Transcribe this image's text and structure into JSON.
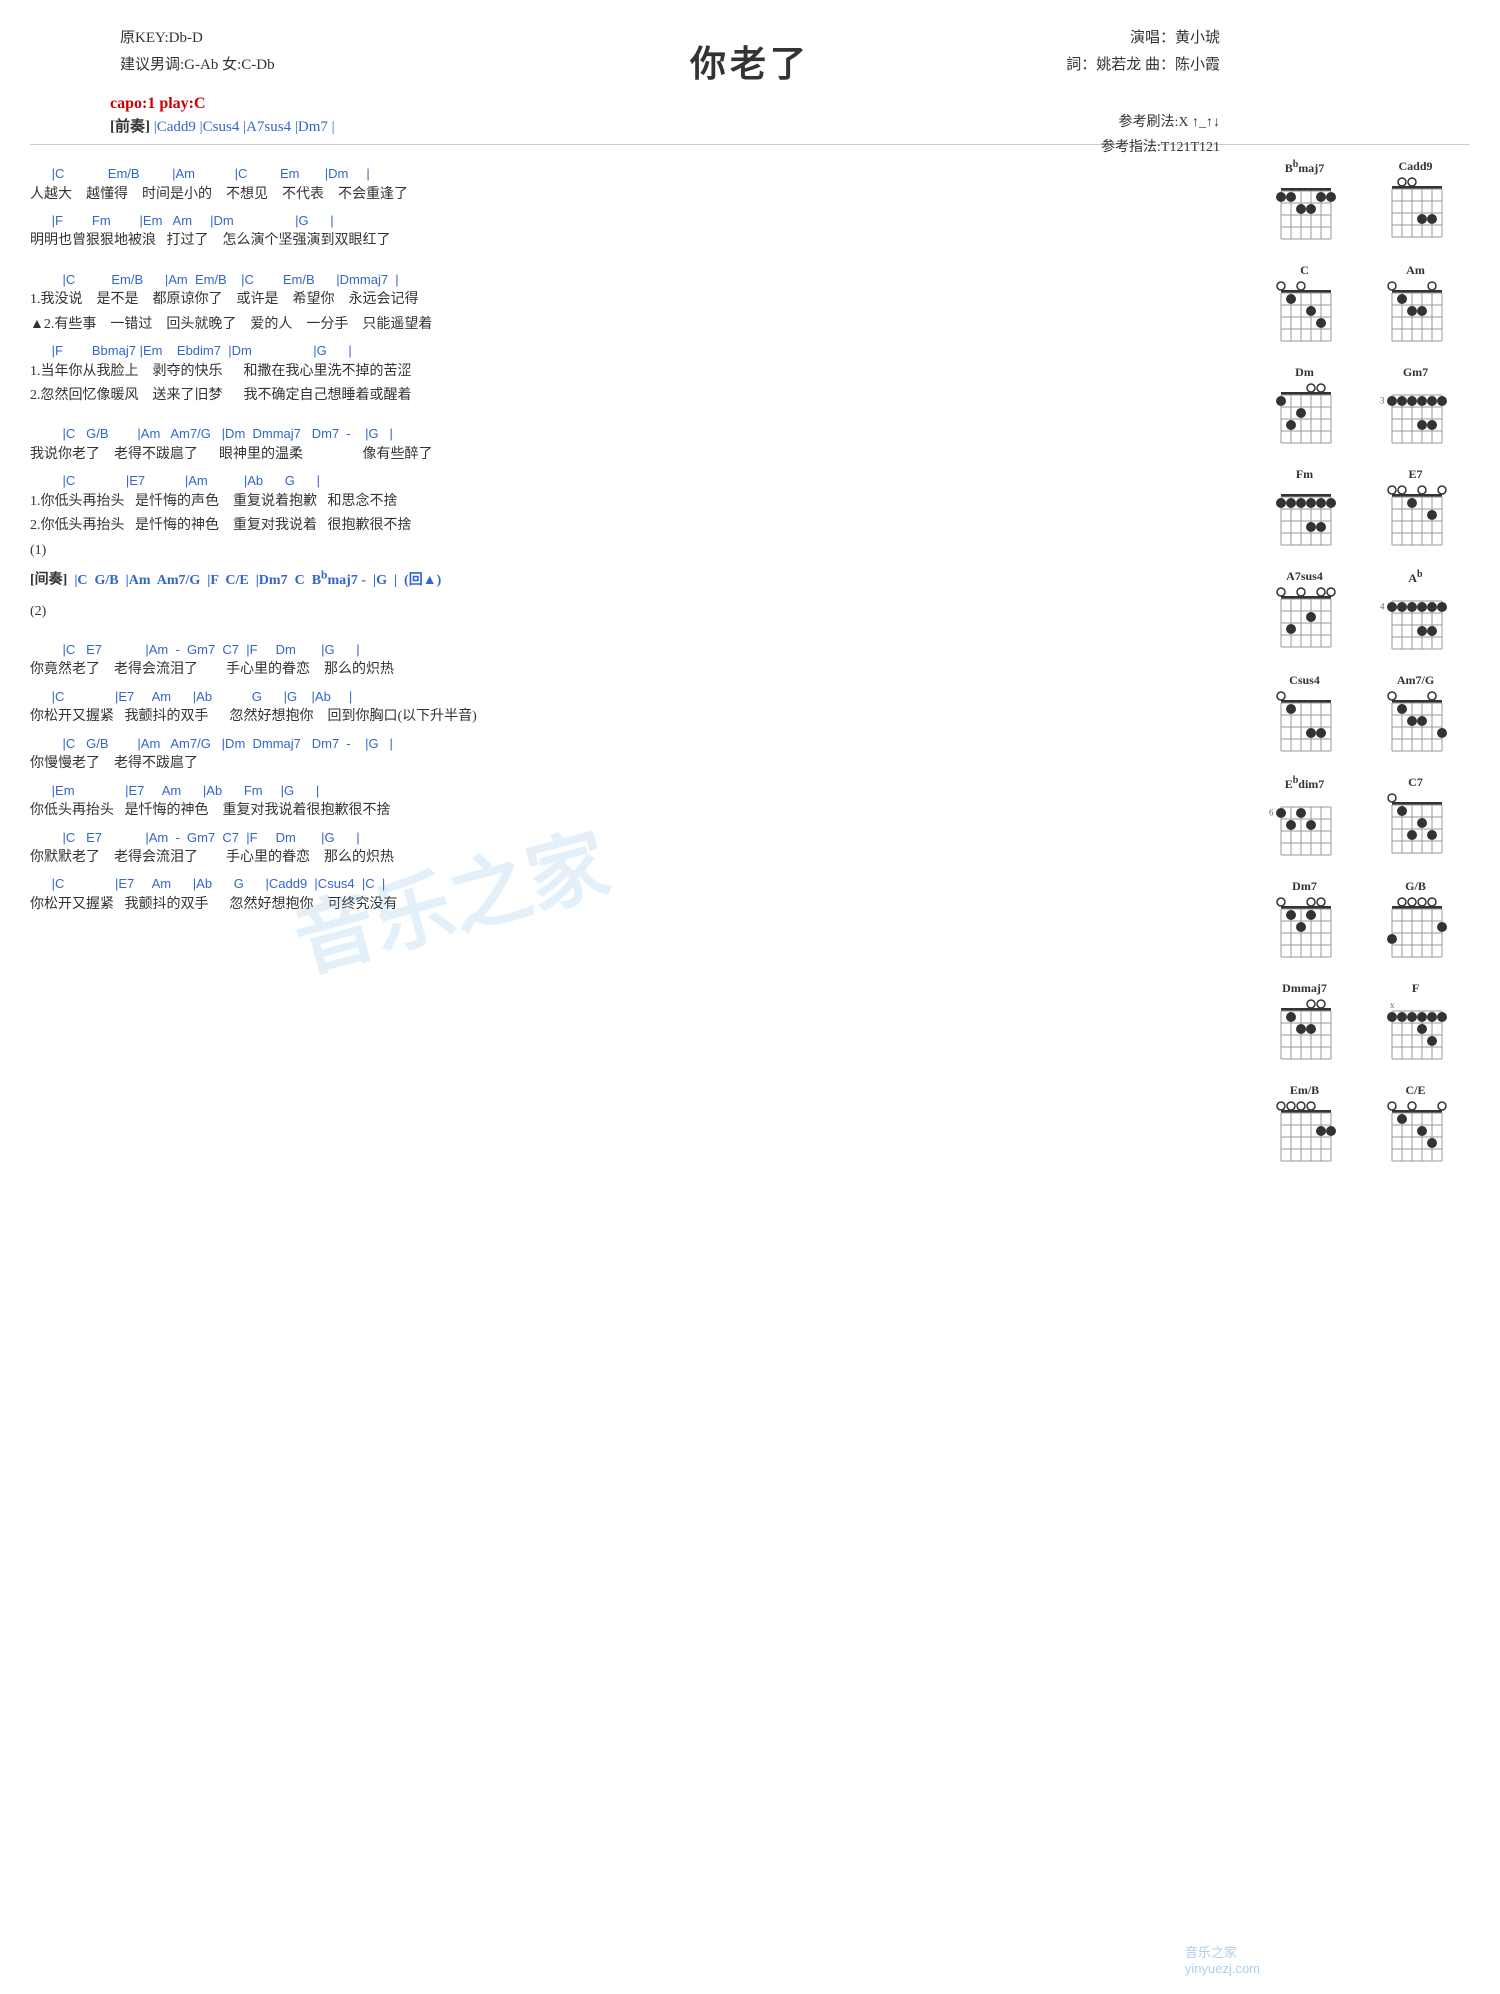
{
  "title": "你老了",
  "meta": {
    "original_key": "原KEY:Db-D",
    "suggested_key": "建议男调:G-Ab 女:C-Db",
    "singer_label": "演唱：黄小琥",
    "lyricist_label": "詞：姚若龙  曲：陈小霞",
    "capo": "capo:1 play:C",
    "strum": "参考刷法:X ↑_↑↓",
    "finger": "参考指法:T121T121"
  },
  "intro": {
    "label": "[前奏]",
    "chords": "|Cadd9  |Csus4  |A7sus4  |Dm7  |"
  },
  "watermark": "音乐之家",
  "watermark_url": "yinyuezj.com",
  "diagrams": [
    {
      "name": "Bbmaj7",
      "fret": "",
      "dots": [
        [
          1,
          1
        ],
        [
          2,
          2
        ],
        [
          2,
          3
        ],
        [
          1,
          4
        ],
        [
          1,
          5
        ]
      ]
    },
    {
      "name": "Cadd9",
      "fret": "",
      "dots": [
        [
          3,
          5
        ],
        [
          3,
          4
        ],
        [
          0,
          3
        ],
        [
          0,
          2
        ],
        [
          3,
          1
        ]
      ]
    },
    {
      "name": "C",
      "fret": "",
      "dots": [
        [
          3,
          5
        ],
        [
          2,
          4
        ],
        [
          0,
          3
        ],
        [
          1,
          2
        ]
      ]
    },
    {
      "name": "Am",
      "fret": "",
      "dots": [
        [
          2,
          4
        ],
        [
          2,
          3
        ],
        [
          1,
          2
        ]
      ]
    },
    {
      "name": "Dm",
      "fret": "",
      "dots": [
        [
          2,
          3
        ],
        [
          3,
          4
        ],
        [
          1,
          2
        ]
      ]
    },
    {
      "name": "Gm7",
      "fret": "3",
      "dots": [
        [
          1,
          1
        ],
        [
          1,
          2
        ],
        [
          1,
          3
        ],
        [
          3,
          4
        ],
        [
          3,
          5
        ],
        [
          1,
          6
        ]
      ]
    },
    {
      "name": "Fm",
      "fret": "",
      "dots": [
        [
          1,
          1
        ],
        [
          1,
          2
        ],
        [
          1,
          3
        ],
        [
          3,
          4
        ],
        [
          3,
          5
        ],
        [
          1,
          6
        ]
      ]
    },
    {
      "name": "E7",
      "fret": "",
      "dots": [
        [
          2,
          5
        ],
        [
          1,
          3
        ],
        [
          2,
          4
        ],
        [
          0,
          2
        ]
      ]
    },
    {
      "name": "A7sus4",
      "fret": "",
      "dots": [
        [
          0,
          5
        ],
        [
          2,
          4
        ],
        [
          0,
          3
        ],
        [
          2,
          2
        ],
        [
          0,
          1
        ]
      ]
    },
    {
      "name": "Ab",
      "fret": "4",
      "dots": [
        [
          1,
          1
        ],
        [
          1,
          2
        ],
        [
          1,
          3
        ],
        [
          3,
          4
        ],
        [
          3,
          5
        ],
        [
          1,
          6
        ]
      ]
    },
    {
      "name": "Csus4",
      "fret": "",
      "dots": [
        [
          3,
          5
        ],
        [
          1,
          2
        ],
        [
          3,
          4
        ]
      ]
    },
    {
      "name": "Am7/G",
      "fret": "",
      "dots": [
        [
          3,
          6
        ],
        [
          2,
          4
        ],
        [
          2,
          3
        ],
        [
          1,
          2
        ]
      ]
    },
    {
      "name": "Ebdim7",
      "fret": "6",
      "dots": [
        [
          1,
          1
        ],
        [
          2,
          2
        ],
        [
          1,
          3
        ],
        [
          2,
          4
        ]
      ]
    },
    {
      "name": "C7",
      "fret": "",
      "dots": [
        [
          3,
          5
        ],
        [
          2,
          4
        ],
        [
          3,
          3
        ],
        [
          1,
          2
        ]
      ]
    },
    {
      "name": "Dm7",
      "fret": "",
      "dots": [
        [
          2,
          3
        ],
        [
          1,
          2
        ],
        [
          1,
          4
        ]
      ]
    },
    {
      "name": "G/B",
      "fret": "",
      "dots": [
        [
          2,
          5
        ],
        [
          0,
          4
        ],
        [
          0,
          3
        ],
        [
          0,
          2
        ],
        [
          2,
          1
        ]
      ]
    },
    {
      "name": "Dmmaj7",
      "fret": "",
      "dots": [
        [
          2,
          3
        ],
        [
          2,
          4
        ],
        [
          1,
          2
        ]
      ]
    },
    {
      "name": "F",
      "fret": "x",
      "dots": [
        [
          1,
          1
        ],
        [
          1,
          2
        ],
        [
          1,
          3
        ],
        [
          2,
          4
        ],
        [
          3,
          5
        ],
        [
          1,
          6
        ]
      ]
    },
    {
      "name": "Em/B",
      "fret": "",
      "dots": [
        [
          2,
          5
        ],
        [
          2,
          4
        ],
        [
          0,
          3
        ],
        [
          0,
          2
        ],
        [
          0,
          1
        ]
      ]
    },
    {
      "name": "C/E",
      "fret": "",
      "dots": [
        [
          0,
          6
        ],
        [
          3,
          5
        ],
        [
          2,
          4
        ],
        [
          0,
          3
        ],
        [
          1,
          2
        ]
      ]
    }
  ],
  "lyrics": [
    {
      "type": "section",
      "text": ""
    },
    {
      "type": "chord",
      "text": "      |C            Em/B         |Am           |C         Em       |Dm     |"
    },
    {
      "type": "lyric",
      "text": "人越大    越懂得    时间是小的    不想见    不代表    不会重逢了"
    },
    {
      "type": "chord",
      "text": "      |F        Fm        |Em   Am     |Dm                 |G      |"
    },
    {
      "type": "lyric",
      "text": "明明也曾狠狠地被浪   打过了    怎么演个坚强演到双眼红了"
    },
    {
      "type": "blank"
    },
    {
      "type": "chord",
      "text": "         |C          Em/B      |Am  Em/B    |C        Em/B      |Dmmaj7  |"
    },
    {
      "type": "lyric",
      "text": "1.我没说    是不是    都原谅你了    或许是    希望你    永远会记得"
    },
    {
      "type": "lyric",
      "text": "▲2.有些事    一错过    回头就晚了    爱的人    一分手    只能遥望着"
    },
    {
      "type": "chord",
      "text": "      |F        Bbmaj7 |Em    Ebdim7  |Dm                 |G      |"
    },
    {
      "type": "lyric",
      "text": "1.当年你从我脸上    剥夺的快乐      和撒在我心里洗不掉的苦涩"
    },
    {
      "type": "lyric",
      "text": "2.忽然回忆像暖风    送来了旧梦      我不确定自己想睡着或醒着"
    },
    {
      "type": "blank"
    },
    {
      "type": "chord",
      "text": "         |C   G/B        |Am   Am7/G   |Dm  Dmmaj7   Dm7  -    |G   |"
    },
    {
      "type": "lyric",
      "text": "我说你老了    老得不跋扈了      眼神里的温柔                 像有些醉了"
    },
    {
      "type": "chord",
      "text": "         |C              |E7           |Am          |Ab      G      |"
    },
    {
      "type": "lyric",
      "text": "1.你低头再抬头   是忏悔的声色    重复说着抱歉   和思念不捨"
    },
    {
      "type": "lyric",
      "text": "2.你低头再抬头   是忏悔的神色    重复对我说着   很抱歉很不捨"
    },
    {
      "type": "lyric",
      "text": "(1)"
    },
    {
      "type": "section_label",
      "text": "[间奏]  |C  G/B  |Am  Am7/G  |F  C/E  |Dm7  C  Bbmaj7 -  |G  |  (回▲)"
    },
    {
      "type": "blank"
    },
    {
      "type": "lyric",
      "text": "(2)"
    },
    {
      "type": "blank"
    },
    {
      "type": "chord",
      "text": "         |C   E7            |Am  -  Gm7  C7  |F     Dm       |G      |"
    },
    {
      "type": "lyric",
      "text": "你竟然老了    老得会流泪了        手心里的眷恋    那么的炽热"
    },
    {
      "type": "chord",
      "text": "      |C              |E7     Am      |Ab           G      |G    |Ab     |"
    },
    {
      "type": "lyric",
      "text": "你松开又握紧   我颤抖的双手      忽然好想抱你    回到你胸口(以下升半音)"
    },
    {
      "type": "chord",
      "text": "         |C   G/B        |Am   Am7/G   |Dm  Dmmaj7   Dm7  -    |G   |"
    },
    {
      "type": "lyric",
      "text": "你慢慢老了    老得不跋扈了"
    },
    {
      "type": "chord",
      "text": "      |Em              |E7     Am      |Ab      Fm     |G      |"
    },
    {
      "type": "lyric",
      "text": "你低头再抬头   是忏悔的神色    重复对我说着很抱歉很不捨"
    },
    {
      "type": "chord",
      "text": "         |C   E7            |Am  -  Gm7  C7  |F     Dm       |G      |"
    },
    {
      "type": "lyric",
      "text": "你默默老了    老得会流泪了        手心里的眷恋    那么的炽热"
    },
    {
      "type": "chord",
      "text": "      |C              |E7     Am      |Ab      G      |Cadd9  |Csus4  |C  |"
    },
    {
      "type": "lyric",
      "text": "你松开又握紧   我颤抖的双手      忽然好想抱你    可终究没有"
    }
  ]
}
